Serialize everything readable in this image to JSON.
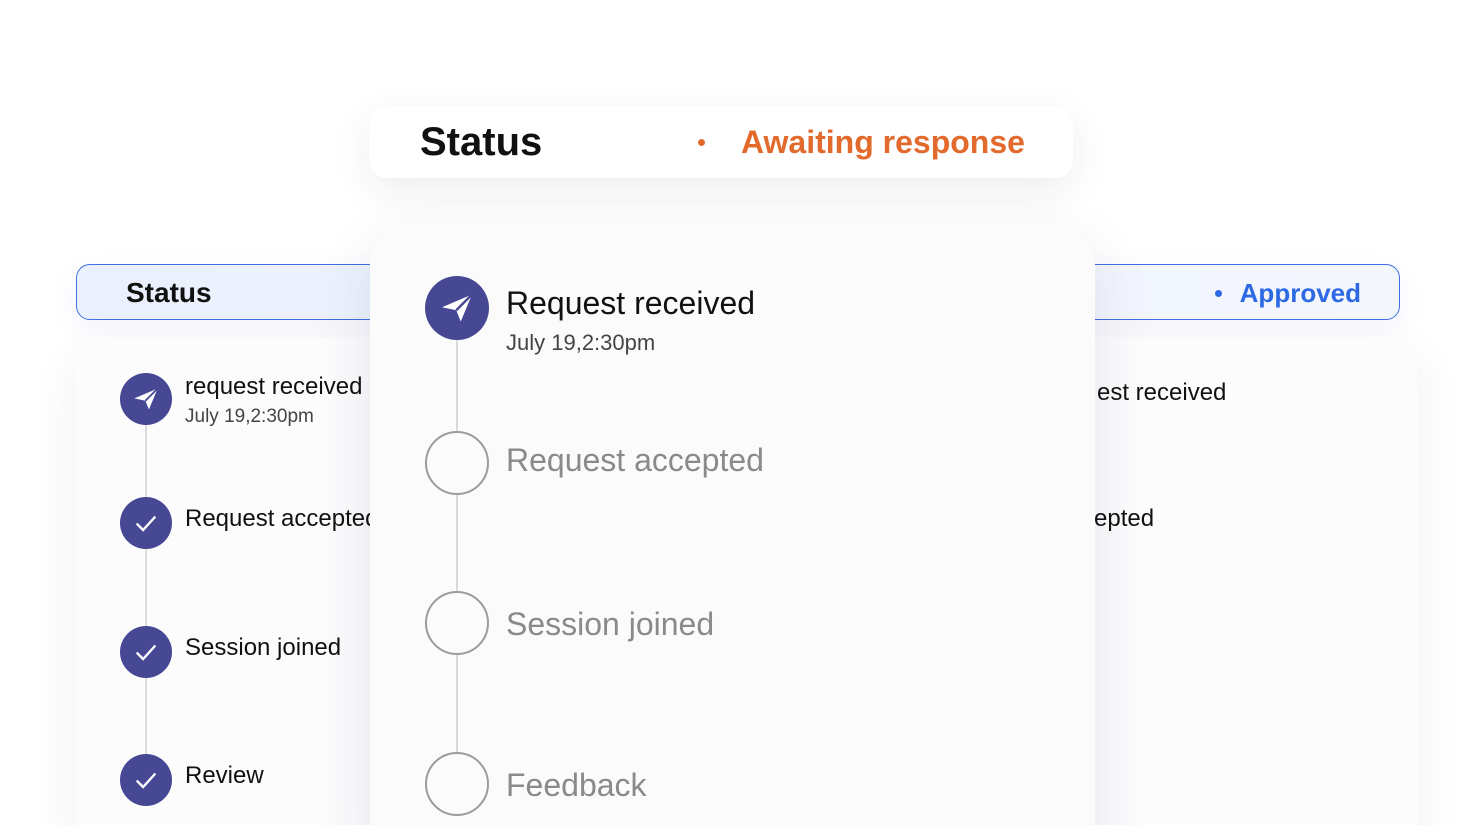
{
  "back_panel": {
    "title": "Status",
    "state": "Approved",
    "accent": "#2c69e3",
    "steps": [
      {
        "label": "request received",
        "time": "July 19,2:30pm",
        "icon": "paper-plane-icon"
      },
      {
        "label": "Request accepted",
        "icon": "check-icon"
      },
      {
        "label": "Session joined",
        "icon": "check-icon"
      },
      {
        "label": "Review",
        "icon": "check-icon"
      }
    ],
    "right_fragments": [
      "est received",
      "epted"
    ]
  },
  "front_panel": {
    "title": "Status",
    "state": "Awaiting response",
    "accent": "#e26a2c",
    "step_color": "#464894",
    "steps": [
      {
        "label": "Request received",
        "time": "July 19,2:30pm",
        "status": "done",
        "icon": "paper-plane-icon"
      },
      {
        "label": "Request accepted",
        "status": "pending"
      },
      {
        "label": "Session joined",
        "status": "pending"
      },
      {
        "label": "Feedback",
        "status": "pending"
      }
    ]
  }
}
